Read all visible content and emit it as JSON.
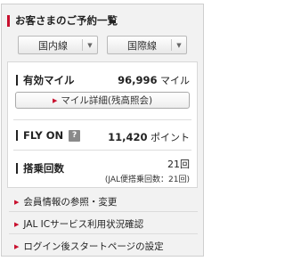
{
  "header": {
    "title": "お客さまのご予約一覧",
    "domestic_label": "国内線",
    "international_label": "国際線",
    "arrow_glyph": "▼"
  },
  "miles": {
    "label": "有効マイル",
    "value": "96,996",
    "unit": "マイル",
    "detail_button": "マイル詳細(残高照会)"
  },
  "flyon": {
    "label": "FLY ON",
    "help_glyph": "?",
    "value": "11,420",
    "unit": "ポイント"
  },
  "boarding": {
    "label": "搭乗回数",
    "count": "21",
    "count_unit": "回",
    "sub_note": "(JAL便搭乗回数：21回)"
  },
  "links": [
    {
      "label": "会員情報の参照・変更"
    },
    {
      "label": "JAL ICサービス利用状況確認"
    },
    {
      "label": "ログイン後スタートページの設定"
    }
  ],
  "colors": {
    "accent_red": "#c8102e",
    "panel_bg": "#f2f2f2",
    "card_bg": "#ffffff"
  },
  "icons": {
    "bullet": "triangle-right-icon",
    "help": "help-icon",
    "dropdown": "chevron-down-icon"
  }
}
